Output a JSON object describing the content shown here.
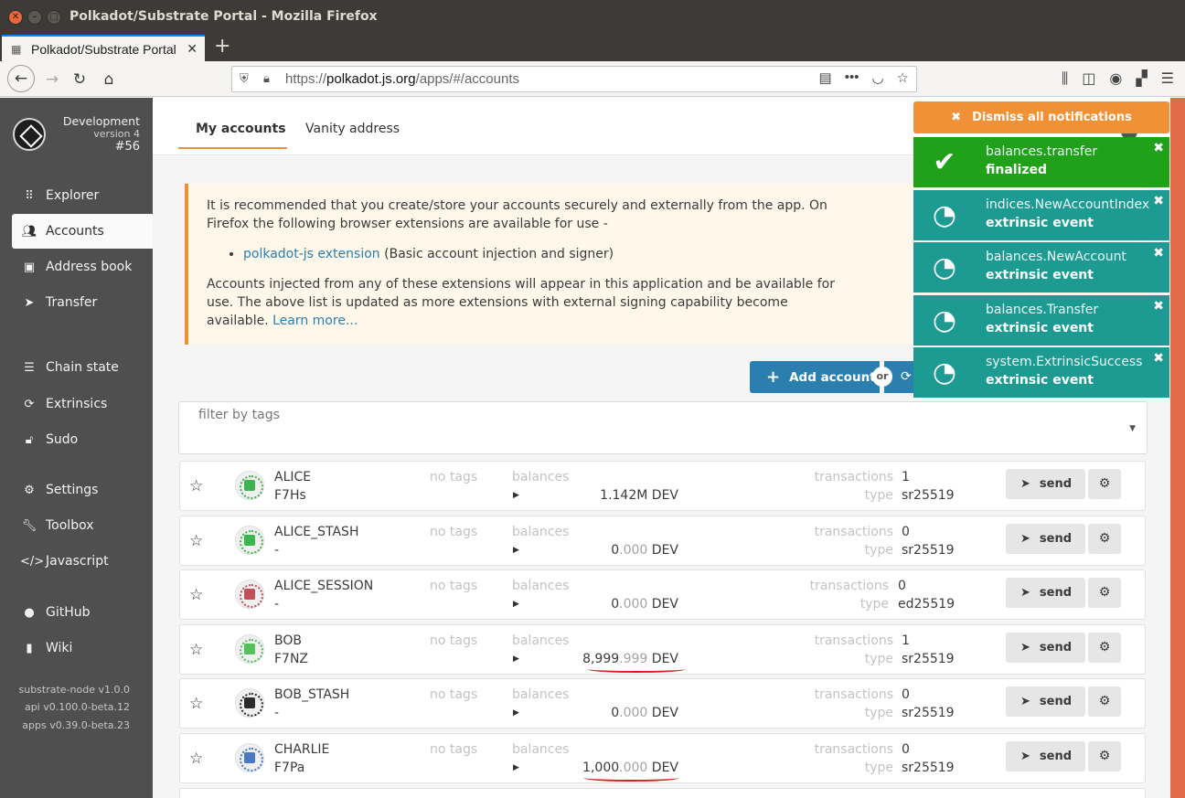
{
  "window": {
    "title": "Polkadot/Substrate Portal - Mozilla Firefox"
  },
  "browser": {
    "tab_title": "Polkadot/Substrate Portal",
    "url_prefix": "https://",
    "url_host": "polkadot.js.org",
    "url_path": "/apps/#/accounts"
  },
  "chain": {
    "name": "Development",
    "version": "version 4",
    "block": "#56"
  },
  "sidebar": {
    "items": [
      {
        "label": "Explorer"
      },
      {
        "label": "Accounts"
      },
      {
        "label": "Address book"
      },
      {
        "label": "Transfer"
      },
      {
        "label": "Chain state"
      },
      {
        "label": "Extrinsics"
      },
      {
        "label": "Sudo"
      },
      {
        "label": "Settings"
      },
      {
        "label": "Toolbox"
      },
      {
        "label": "Javascript"
      },
      {
        "label": "GitHub"
      },
      {
        "label": "Wiki"
      }
    ],
    "footer": [
      "substrate-node v1.0.0",
      "api v0.100.0-beta.12",
      "apps v0.39.0-beta.23"
    ]
  },
  "tabs": {
    "my_accounts": "My accounts",
    "vanity": "Vanity address"
  },
  "banner": {
    "text1": "It is recommended that you create/store your accounts securely and externally from the app. On Firefox the following browser extensions are available for use -",
    "ext_link": "polkadot-js extension",
    "ext_desc": " (Basic account injection and signer)",
    "text2": "Accounts injected from any of these extensions will appear in this application and be available for use. The above list is updated as more extensions with external signing capability become available. ",
    "learn_more": "Learn more..."
  },
  "actions": {
    "add_account": "Add account",
    "or": "or"
  },
  "filter": {
    "placeholder": "filter by tags"
  },
  "labels": {
    "no_tags": "no tags",
    "balances": "balances",
    "transactions": "transactions",
    "type": "type",
    "send": "send"
  },
  "accounts": [
    {
      "name": "ALICE",
      "short": "F7Hs",
      "balance_int": "1.142M",
      "balance_dec": "",
      "unit": " DEV",
      "transactions": "1",
      "type": "sr25519",
      "color": "#3fb34f"
    },
    {
      "name": "ALICE_STASH",
      "short": "-",
      "balance_int": "0",
      "balance_dec": ".000",
      "unit": " DEV",
      "transactions": "0",
      "type": "sr25519",
      "color": "#3bb84b"
    },
    {
      "name": "ALICE_SESSION",
      "short": "-",
      "balance_int": "0",
      "balance_dec": ".000",
      "unit": " DEV",
      "transactions": "0",
      "type": "ed25519",
      "color": "#c0505a"
    },
    {
      "name": "BOB",
      "short": "F7NZ",
      "balance_int": "8,999",
      "balance_dec": ".999",
      "unit": " DEV",
      "transactions": "1",
      "type": "sr25519",
      "color": "#52c15a"
    },
    {
      "name": "BOB_STASH",
      "short": "-",
      "balance_int": "0",
      "balance_dec": ".000",
      "unit": " DEV",
      "transactions": "0",
      "type": "sr25519",
      "color": "#2b2b2b"
    },
    {
      "name": "CHARLIE",
      "short": "F7Pa",
      "balance_int": "1,000",
      "balance_dec": ".000",
      "unit": " DEV",
      "transactions": "0",
      "type": "sr25519",
      "color": "#4a79c4"
    }
  ],
  "notifications": {
    "dismiss_all": "Dismiss all notifications",
    "items": [
      {
        "title": "balances.transfer",
        "status": "finalized",
        "kind": "success"
      },
      {
        "title": "indices.NewAccountIndex",
        "status": "extrinsic event",
        "kind": "event"
      },
      {
        "title": "balances.NewAccount",
        "status": "extrinsic event",
        "kind": "event"
      },
      {
        "title": "balances.Transfer",
        "status": "extrinsic event",
        "kind": "event"
      },
      {
        "title": "system.ExtrinsicSuccess",
        "status": "extrinsic event",
        "kind": "event"
      }
    ]
  },
  "colors": {
    "accent": "#f19135",
    "primary": "#2a7faf",
    "success": "#21a11a",
    "event": "#1d9b93"
  }
}
